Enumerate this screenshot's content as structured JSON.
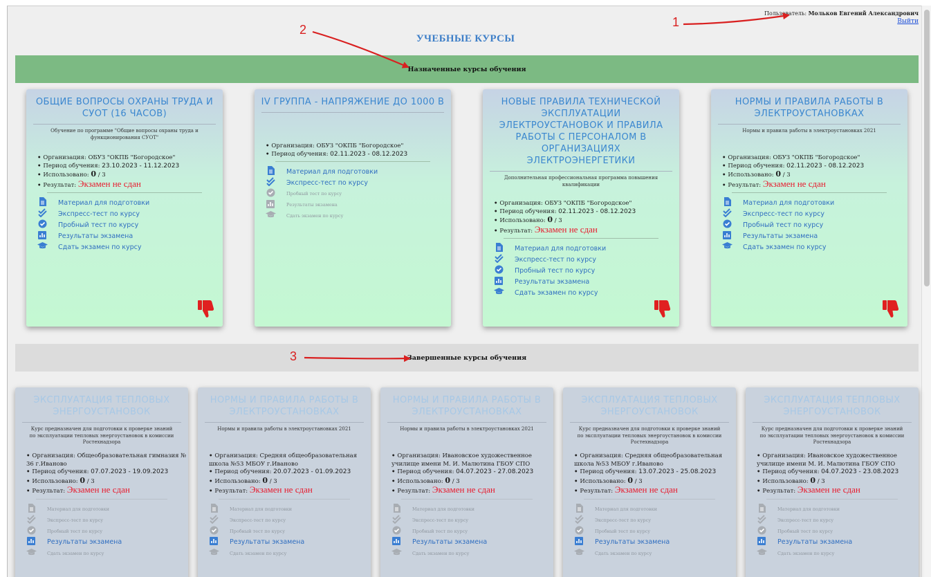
{
  "header": {
    "user_label": "Пользователь:",
    "user_name": "Мольков Евгений Александрович",
    "logout": "Выйти",
    "title": "УЧЕБНЫЕ КУРСЫ"
  },
  "sections": {
    "assigned": "Назначенные курсы обучения",
    "completed": "Завершенные курсы обучения"
  },
  "annotations": [
    "1",
    "2",
    "3"
  ],
  "labels": {
    "org": "Организация:",
    "period": "Период обучения:",
    "used": "Использовано:",
    "result": "Результат:"
  },
  "action_labels": {
    "material": "Материал для подготовки",
    "express": "Экспресс-тест по курсу",
    "trial": "Пробный тест по курсу",
    "results": "Результаты экзамена",
    "exam": "Сдать экзамен по курсу"
  },
  "icons": {
    "material": "document-icon",
    "express": "double-check-icon",
    "trial": "check-circle-icon",
    "results": "bar-chart-icon",
    "exam": "graduation-cap-icon",
    "status": "thumbs-down-icon"
  },
  "assigned_courses": [
    {
      "title": "ОБЩИЕ ВОПРОСЫ ОХРАНЫ ТРУДА И СУОТ (16 ЧАСОВ)",
      "desc": "Обучение по программе \"Общие вопросы охраны труда и функционирования СУОТ\"",
      "org": "ОБУЗ \"ОКПБ \"Богородское\"",
      "period": "23.10.2023 - 11.12.2023",
      "used": "0",
      "used_total": "/ 3",
      "result": "Экзамен не сдан"
    },
    {
      "title": "IV ГРУППА - НАПРЯЖЕНИЕ ДО 1000 В",
      "desc": "",
      "org": "ОБУЗ \"ОКПБ \"Богородское\"",
      "period": "02.11.2023 - 08.12.2023",
      "used": "",
      "used_total": "",
      "result": ""
    },
    {
      "title": "НОВЫЕ ПРАВИЛА ТЕХНИЧЕСКОЙ ЭКСПЛУАТАЦИИ ЭЛЕКТРОУСТАНОВОК И ПРАВИЛА РАБОТЫ С ПЕРСОНАЛОМ В ОРГАНИЗАЦИЯХ ЭЛЕКТРОЭНЕРГЕТИКИ",
      "desc": "Дополнительная профессиональная программа повышения квалификации",
      "org": "ОБУЗ \"ОКПБ \"Богородское\"",
      "period": "02.11.2023 - 08.12.2023",
      "used": "0",
      "used_total": "/ 3",
      "result": "Экзамен не сдан"
    },
    {
      "title": "НОРМЫ И ПРАВИЛА РАБОТЫ В ЭЛЕКТРОУСТАНОВКАХ",
      "desc": "Нормы и правила работы в электроустановках 2021",
      "org": "ОБУЗ \"ОКПБ \"Богородское\"",
      "period": "02.11.2023 - 08.12.2023",
      "used": "0",
      "used_total": "/ 3",
      "result": "Экзамен не сдан"
    }
  ],
  "completed_courses": [
    {
      "title": "ЭКСПЛУАТАЦИЯ ТЕПЛОВЫХ ЭНЕРГОУСТАНОВОК",
      "desc": "Курс предназначен для подготовки к проверке знаний по эксплуатации тепловых энергоустановок в комиссии Ростехнадзора",
      "org": "Общеобразовательная гимназия № 36 г.Иваново",
      "period": "07.07.2023 - 19.09.2023",
      "used": "0",
      "used_total": "/ 3",
      "result": "Экзамен не сдан"
    },
    {
      "title": "НОРМЫ И ПРАВИЛА РАБОТЫ В ЭЛЕКТРОУСТАНОВКАХ",
      "desc": "Нормы и правила работы в электроустановках 2021",
      "org": "Средняя общеобразовательная школа №53 МБОУ г.Иваново",
      "period": "20.07.2023 - 01.09.2023",
      "used": "0",
      "used_total": "/ 3",
      "result": "Экзамен не сдан"
    },
    {
      "title": "НОРМЫ И ПРАВИЛА РАБОТЫ В ЭЛЕКТРОУСТАНОВКАХ",
      "desc": "Нормы и правила работы в электроустановках 2021",
      "org": "Ивановское художественное училище имени М. И. Малютина ГБОУ СПО",
      "period": "04.07.2023 - 27.08.2023",
      "used": "0",
      "used_total": "/ 3",
      "result": "Экзамен не сдан"
    },
    {
      "title": "ЭКСПЛУАТАЦИЯ ТЕПЛОВЫХ ЭНЕРГОУСТАНОВОК",
      "desc": "Курс предназначен для подготовки к проверке знаний по эксплуатации тепловых энергоустановок в комиссии Ростехнадзора",
      "org": "Средняя общеобразовательная школа №53 МБОУ г.Иваново",
      "period": "13.07.2023 - 25.08.2023",
      "used": "0",
      "used_total": "/ 3",
      "result": "Экзамен не сдан"
    },
    {
      "title": "ЭКСПЛУАТАЦИЯ ТЕПЛОВЫХ ЭНЕРГОУСТАНОВОК",
      "desc": "Курс предназначен для подготовки к проверке знаний по эксплуатации тепловых энергоустановок в комиссии Ростехнадзора",
      "org": "Ивановское художественное училище имени М. И. Малютина ГБОУ СПО",
      "period": "04.07.2023 - 23.08.2023",
      "used": "0",
      "used_total": "/ 3",
      "result": "Экзамен не сдан"
    }
  ],
  "colors": {
    "accent": "#3a87cf",
    "fail": "#e8192c",
    "assigned_bar": "#7cba83",
    "completed_bar": "#dcdcdc",
    "annotation": "#d92020"
  }
}
